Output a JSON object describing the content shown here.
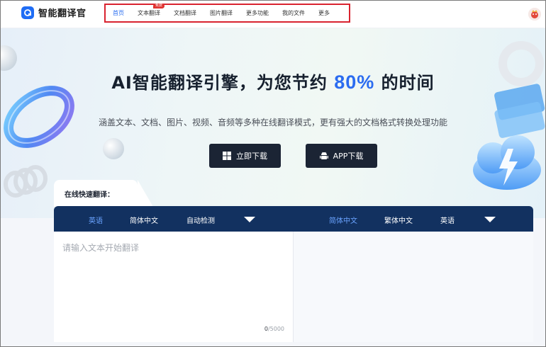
{
  "app": {
    "name": "智能翻译官"
  },
  "nav": {
    "items": [
      {
        "label": "首页",
        "active": true
      },
      {
        "label": "文本翻译",
        "badge": "免费"
      },
      {
        "label": "文档翻译"
      },
      {
        "label": "图片翻译"
      },
      {
        "label": "更多功能"
      },
      {
        "label": "我的文件"
      },
      {
        "label": "更多"
      }
    ]
  },
  "hero": {
    "headline_pre": "AI智能翻译引擎，为您节约 ",
    "headline_pct": "80%",
    "headline_post": " 的时间",
    "subtitle": "涵盖文本、文档、图片、视频、音频等多种在线翻译模式，更有强大的文档格式转换处理功能",
    "download_button": "立即下载",
    "app_button": "APP下载"
  },
  "translator": {
    "section_label": "在线快速翻译：",
    "source_langs": [
      "英语",
      "简体中文",
      "自动检测"
    ],
    "source_selected": "英语",
    "target_langs": [
      "简体中文",
      "繁体中文",
      "英语"
    ],
    "target_selected": "简体中文",
    "input_placeholder": "请输入文本开始翻译",
    "char_count": "0",
    "char_limit": "/5000"
  },
  "colors": {
    "accent": "#2b6cf0",
    "lang_bar": "#123160",
    "button_dark": "#1b2434",
    "nav_highlight_border": "#d9232f",
    "badge": "#e0322f"
  },
  "icons": [
    "logo-icon",
    "windows-icon",
    "android-icon",
    "chevron-down-icon",
    "avatar"
  ]
}
